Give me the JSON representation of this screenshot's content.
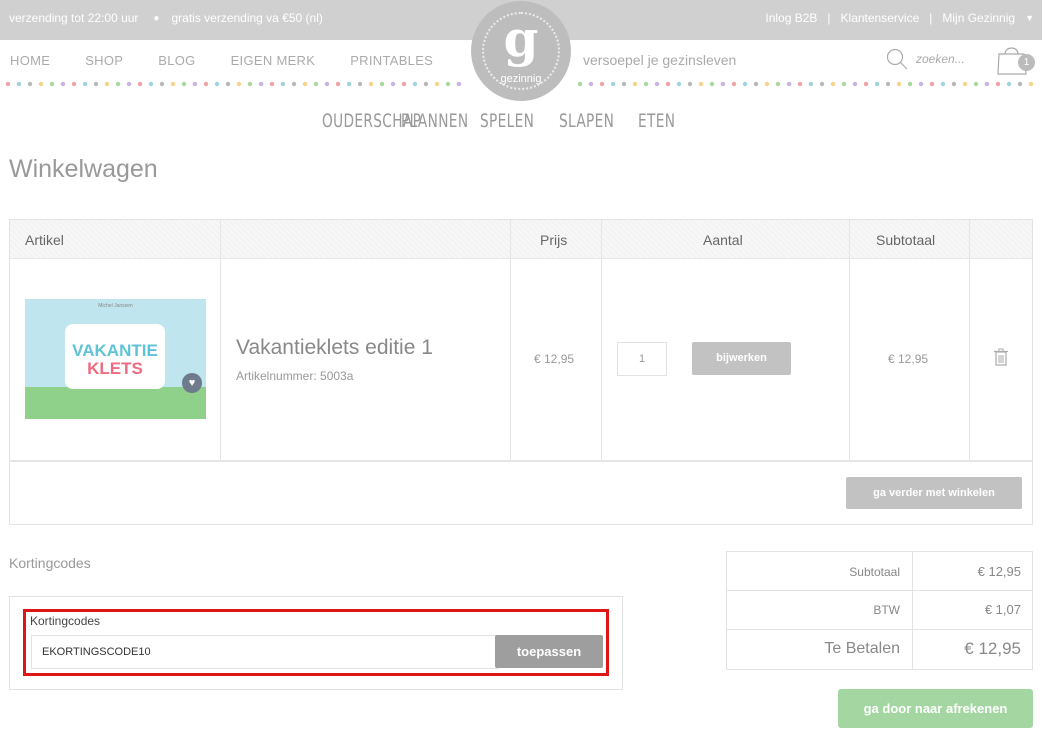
{
  "topbar": {
    "shipping_time": "verzending tot 22:00 uur",
    "free_shipping": "gratis verzending va €50 (nl)",
    "links": [
      "Inlog B2B",
      "Klantenservice",
      "Mijn Gezinnig"
    ]
  },
  "nav": {
    "links": [
      "HOME",
      "SHOP",
      "BLOG",
      "EIGEN MERK",
      "PRINTABLES"
    ],
    "tagline": "versoepel je gezinsleven",
    "search_placeholder": "zoeken...",
    "cart_count": "1"
  },
  "logo": {
    "glyph": "g",
    "name": "gezinnig"
  },
  "subnav": [
    "OUDERSCHAP",
    "PLANNEN",
    "SPELEN",
    "SLAPEN",
    "ETEN"
  ],
  "page_title": "Winkelwagen",
  "cart": {
    "headers": {
      "article": "Artikel",
      "price": "Prijs",
      "quantity": "Aantal",
      "subtotal": "Subtotaal"
    },
    "item": {
      "cover_author": "Michel Janssen",
      "cover_title_1": "VAKANTIE",
      "cover_title_2": "KLETS",
      "name": "Vakantieklets editie 1",
      "sku": "Artikelnummer: 5003a",
      "price": "€ 12,95",
      "quantity": "1",
      "update_label": "bijwerken",
      "subtotal": "€ 12,95"
    },
    "continue_label": "ga verder met winkelen"
  },
  "discount": {
    "section_title": "Kortingcodes",
    "label": "Kortingcodes",
    "value": "EKORTINGSCODE10",
    "apply_label": "toepassen"
  },
  "totals": {
    "subtotal_label": "Subtotaal",
    "subtotal_value": "€ 12,95",
    "vat_label": "BTW",
    "vat_value": "€ 1,07",
    "total_label": "Te Betalen",
    "total_value": "€ 12,95"
  },
  "checkout_label": "ga door naar afrekenen",
  "colors": {
    "checkout_green": "#a4d6a2",
    "highlight_red": "#e01515",
    "button_grey": "#c2c2c2"
  }
}
